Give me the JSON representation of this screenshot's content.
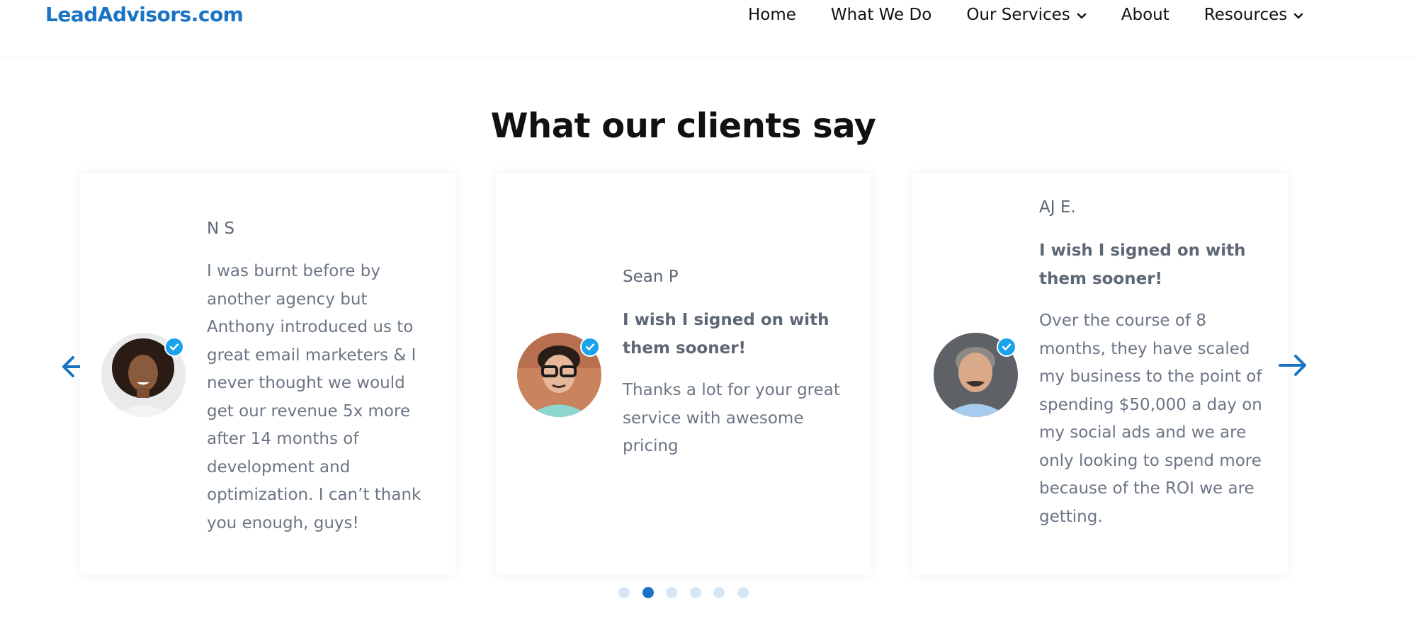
{
  "header": {
    "logo": "LeadAdvisors.com",
    "nav": [
      {
        "label": "Home",
        "has_dropdown": false
      },
      {
        "label": "What We Do",
        "has_dropdown": false
      },
      {
        "label": "Our Services",
        "has_dropdown": true
      },
      {
        "label": "About",
        "has_dropdown": false
      },
      {
        "label": "Resources",
        "has_dropdown": true
      }
    ]
  },
  "section": {
    "title": "What our clients say"
  },
  "testimonials": [
    {
      "name": "N S",
      "headline": "",
      "quote": "I was burnt before by another agency but Anthony introduced us to great email marketers & I never thought we would get our revenue 5x more after 14 months of development and optimization. I can’t thank you enough, guys!",
      "avatar": "woman-curly-hair-avatar"
    },
    {
      "name": "Sean P",
      "headline": "I wish I signed on with them sooner!",
      "quote": "Thanks a lot for your great service with awesome pricing",
      "avatar": "man-glasses-avatar"
    },
    {
      "name": "AJ E.",
      "headline": "I wish I signed on with them sooner!",
      "quote": "Over the course of 8 months, they have scaled my business to the point of spending $50,000 a day on my social ads and we are only looking to spend more because of the ROI we are getting.",
      "avatar": "man-gray-hair-avatar"
    }
  ],
  "carousel": {
    "dot_count": 6,
    "active_dot": 2,
    "prev_icon": "arrow-left-icon",
    "next_icon": "arrow-right-icon"
  },
  "colors": {
    "brand": "#1a73c4",
    "verified": "#1aa3ec",
    "text_muted": "#6c7684",
    "dot_inactive": "#d6e6f4"
  }
}
